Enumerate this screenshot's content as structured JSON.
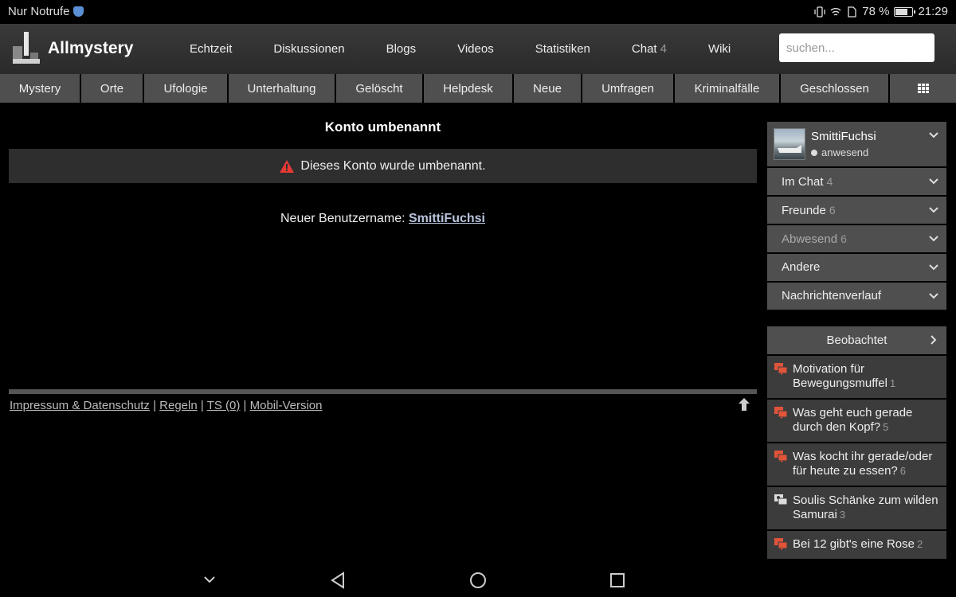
{
  "statusbar": {
    "carrier": "Nur Notrufe",
    "battery_text": "78 %",
    "battery_level": 0.78,
    "time": "21:29"
  },
  "header": {
    "brand": "Allmystery",
    "nav": [
      {
        "label": "Echtzeit"
      },
      {
        "label": "Diskussionen"
      },
      {
        "label": "Blogs"
      },
      {
        "label": "Videos"
      },
      {
        "label": "Statistiken"
      },
      {
        "label": "Chat",
        "count": "4"
      },
      {
        "label": "Wiki"
      }
    ],
    "search_placeholder": "suchen..."
  },
  "categories": [
    {
      "label": "Mystery"
    },
    {
      "label": "Orte"
    },
    {
      "label": "Ufologie"
    },
    {
      "label": "Unterhaltung"
    },
    {
      "label": "Gelöscht"
    },
    {
      "label": "Helpdesk"
    },
    {
      "label": "Neue"
    },
    {
      "label": "Umfragen"
    },
    {
      "label": "Kriminalfälle"
    },
    {
      "label": "Geschlossen"
    }
  ],
  "main": {
    "title": "Konto umbenannt",
    "alert": "Dieses Konto wurde umbenannt.",
    "rename_label": "Neuer Benutzername:",
    "new_username": "SmittiFuchsi"
  },
  "footer": {
    "links": [
      "Impressum & Datenschutz",
      "Regeln",
      "TS (0)",
      "Mobil-Version"
    ],
    "separator": "|"
  },
  "sidebar": {
    "username": "SmittiFuchsi",
    "status": "anwesend",
    "items": [
      {
        "label": "Im Chat",
        "count": "4"
      },
      {
        "label": "Freunde",
        "count": "6"
      },
      {
        "label": "Abwesend",
        "count": "6"
      },
      {
        "label": "Andere",
        "count": ""
      },
      {
        "label": "Nachrichtenverlauf",
        "count": ""
      }
    ]
  },
  "watched": {
    "title": "Beobachtet",
    "items": [
      {
        "title": "Motivation für Bewegungsmuffel",
        "count": "1",
        "icon": "discussion-icon"
      },
      {
        "title": "Was geht euch gerade durch den Kopf?",
        "count": "5",
        "icon": "discussion-icon"
      },
      {
        "title": "Was kocht ihr gerade/oder für heute zu essen?",
        "count": "6",
        "icon": "discussion-icon"
      },
      {
        "title": "Soulis Schänke zum wilden Samurai",
        "count": "3",
        "icon": "group-discussion-icon"
      },
      {
        "title": "Bei 12 gibt's eine Rose",
        "count": "2",
        "icon": "discussion-icon"
      }
    ]
  },
  "colors": {
    "header_bg": "#333333",
    "catbar_bg": "#4f4f4f",
    "alert_icon": "#e53935",
    "discussion_icon": "#e0543a",
    "link": "#b8c4dc"
  }
}
